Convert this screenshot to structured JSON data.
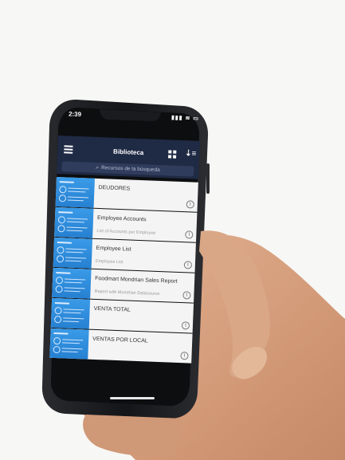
{
  "status": {
    "time": "2:39",
    "icons": "▮▮▮ ≋ ▭"
  },
  "app": {
    "title": "Biblioteca"
  },
  "search": {
    "placeholder": "Recursos de la búsqueda"
  },
  "items": [
    {
      "title": "DEUDORES",
      "subtitle": ""
    },
    {
      "title": "Employee Accounts",
      "subtitle": "List of Accounts per Employee"
    },
    {
      "title": "Employee List",
      "subtitle": "Employee List"
    },
    {
      "title": "Foodmart Mondrian Sales Report",
      "subtitle": "Report with Mondrian Datasource"
    },
    {
      "title": "VENTA TOTAL",
      "subtitle": ""
    },
    {
      "title": "VENTAS POR LOCAL",
      "subtitle": ""
    }
  ],
  "icons": {
    "menu": "hamburger-menu-icon",
    "grid": "grid-view-icon",
    "sort": "sort-icon",
    "search": "search-icon",
    "info": "info-icon"
  },
  "colors": {
    "header": "#1f2a44",
    "thumbnail": "#2680d1",
    "phone_body": "#1c1d20",
    "skin": "#d9a786"
  }
}
